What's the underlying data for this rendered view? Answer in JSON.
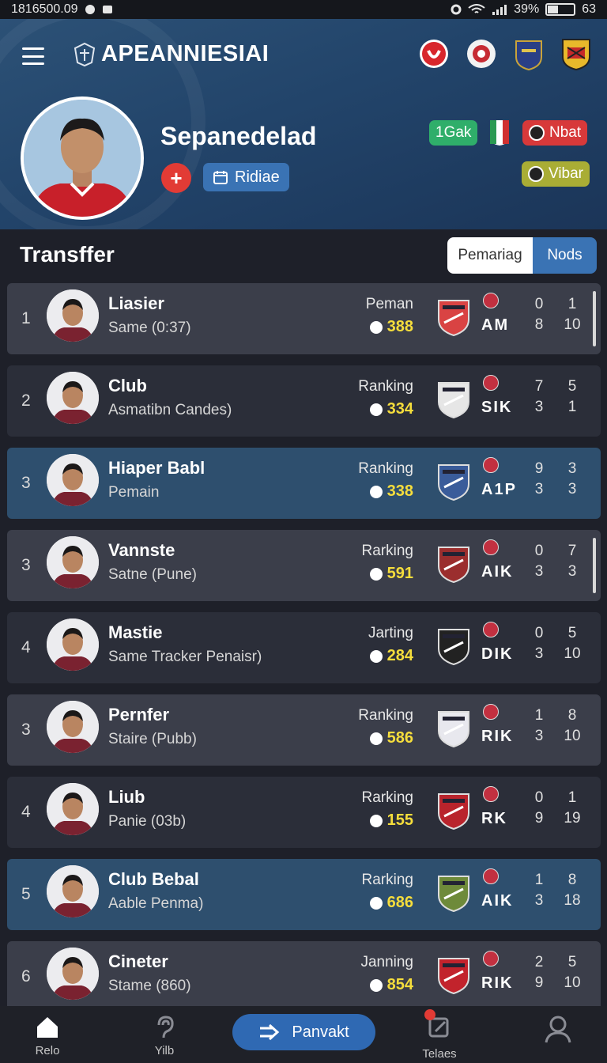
{
  "status_bar": {
    "left_text": "1816500.09",
    "battery_percent": "39%",
    "right_text": "63"
  },
  "header": {
    "brand": "APEANNIESIAI",
    "profile_name": "Sepanedelad",
    "fav_symbol": "+",
    "schedule_label": "Ridiae",
    "tags": {
      "green": "1Gak",
      "red": "Nbat",
      "yellow": "Vibar"
    }
  },
  "section": {
    "title": "Transffer",
    "seg_left": "Pemariag",
    "seg_right": "Nods"
  },
  "rows": [
    {
      "rank": "1",
      "name": "Liasier",
      "sub": "Same (0:37)",
      "label": "Peman",
      "score": "388",
      "code": "AM",
      "s1": "0",
      "s2": "1",
      "s3": "8",
      "s4": "10",
      "style": "mid",
      "crest_color": "#d94343"
    },
    {
      "rank": "2",
      "name": "Club",
      "sub": "Asmatibn Candes)",
      "label": "Ranking",
      "score": "334",
      "code": "SIK",
      "s1": "7",
      "s2": "5",
      "s3": "3",
      "s4": "1",
      "style": "dark",
      "crest_color": "#e6e6e6"
    },
    {
      "rank": "3",
      "name": "Hiaper Babl",
      "sub": "Pemain",
      "label": "Ranking",
      "score": "338",
      "code": "A1P",
      "s1": "9",
      "s2": "3",
      "s3": "3",
      "s4": "3",
      "style": "blue",
      "crest_color": "#3a5c9a"
    },
    {
      "rank": "3",
      "name": "Vannste",
      "sub": "Satne (Pune)",
      "label": "Rarking",
      "score": "591",
      "code": "AIK",
      "s1": "0",
      "s2": "7",
      "s3": "3",
      "s4": "3",
      "style": "mid",
      "crest_color": "#9b2e2e"
    },
    {
      "rank": "4",
      "name": "Mastie",
      "sub": "Same Tracker Penaisr)",
      "label": "Jarting",
      "score": "284",
      "code": "DIK",
      "s1": "0",
      "s2": "5",
      "s3": "3",
      "s4": "10",
      "style": "dark",
      "crest_color": "#222222"
    },
    {
      "rank": "3",
      "name": "Pernfer",
      "sub": "Staire (Pubb)",
      "label": "Ranking",
      "score": "586",
      "code": "RIK",
      "s1": "1",
      "s2": "8",
      "s3": "3",
      "s4": "10",
      "style": "mid",
      "crest_color": "#e8e8ee"
    },
    {
      "rank": "4",
      "name": "Liub",
      "sub": "Panie (03b)",
      "label": "Rarking",
      "score": "155",
      "code": "RK",
      "s1": "0",
      "s2": "1",
      "s3": "9",
      "s4": "19",
      "style": "dark",
      "crest_color": "#b9242c"
    },
    {
      "rank": "5",
      "name": "Club Bebal",
      "sub": "Aable Penma)",
      "label": "Rarking",
      "score": "686",
      "code": "AIK",
      "s1": "1",
      "s2": "8",
      "s3": "3",
      "s4": "18",
      "style": "blue",
      "crest_color": "#6e8a3a"
    },
    {
      "rank": "6",
      "name": "Cineter",
      "sub": "Stame (860)",
      "label": "Janning",
      "score": "854",
      "code": "RIK",
      "s1": "2",
      "s2": "5",
      "s3": "9",
      "s4": "10",
      "style": "mid",
      "crest_color": "#c2232c"
    }
  ],
  "bottom_nav": {
    "home": "Relo",
    "yib": "Yilb",
    "pill": "Panvakt",
    "tel": "Telaes"
  }
}
